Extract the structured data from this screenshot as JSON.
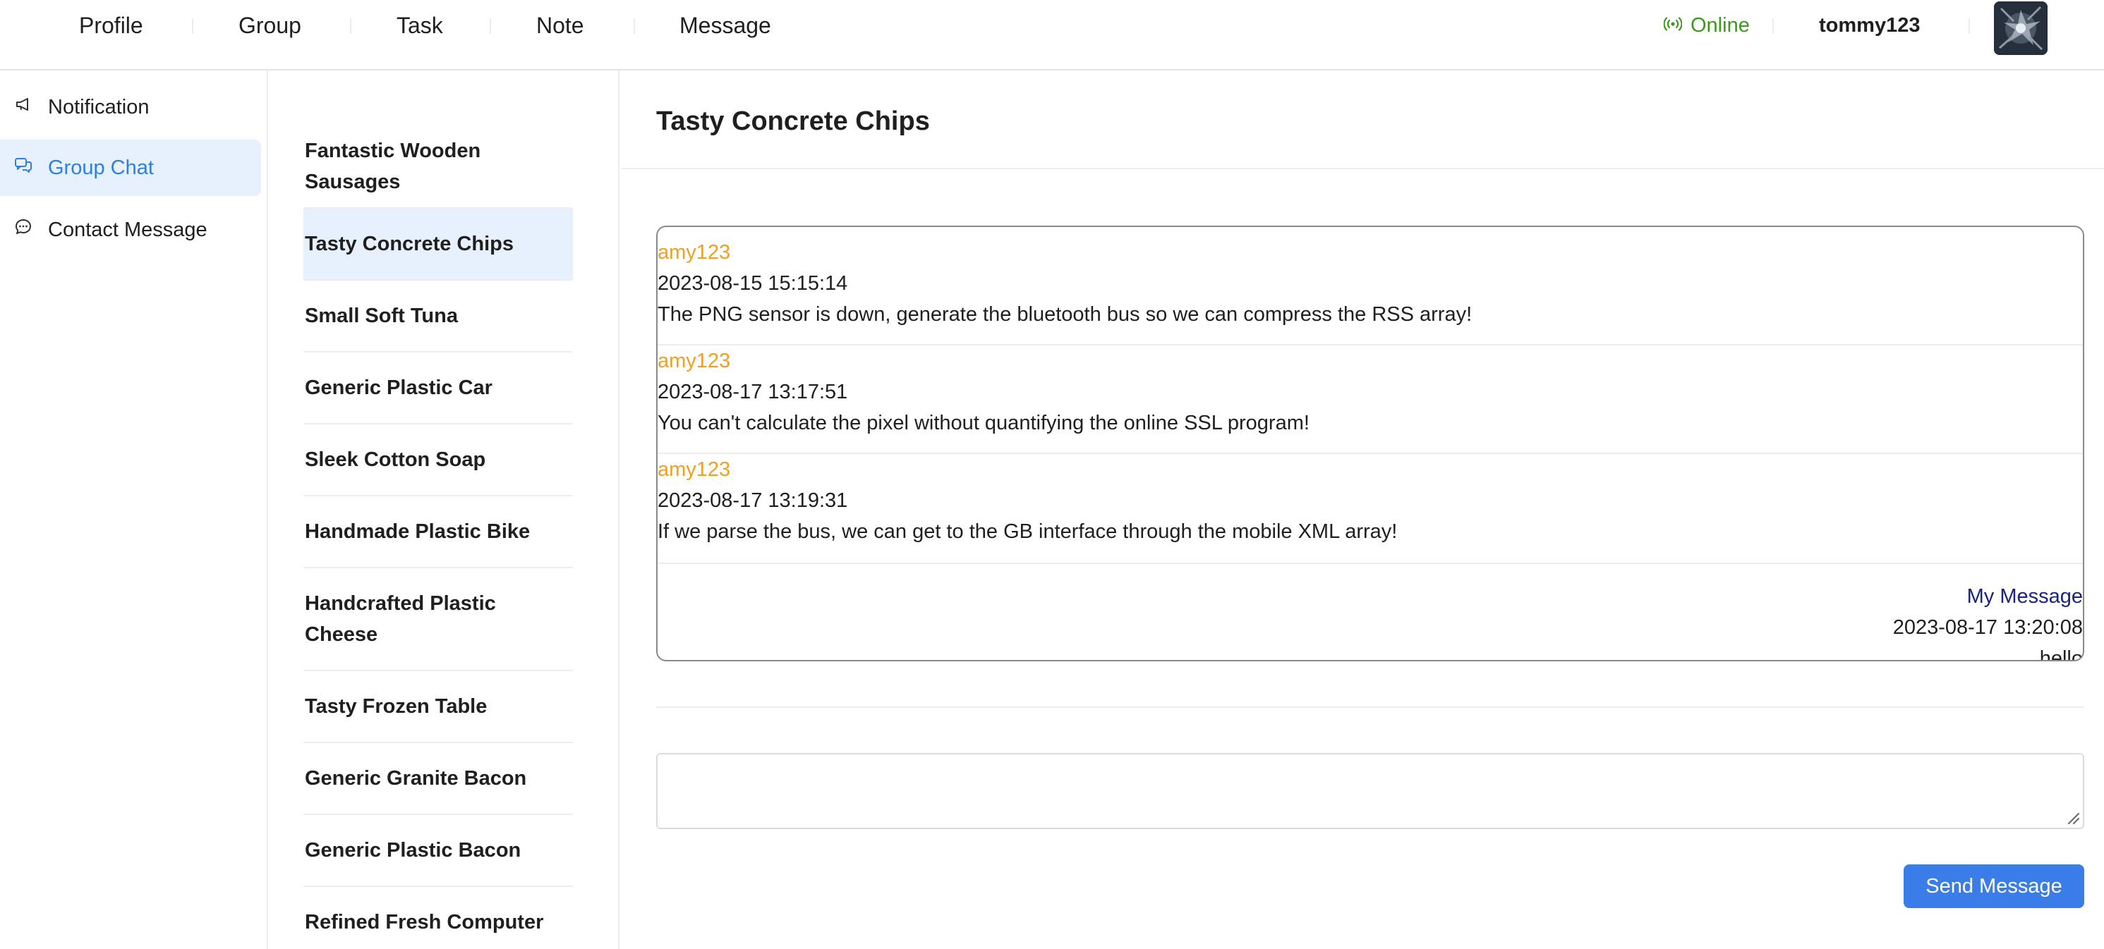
{
  "nav": {
    "items": [
      "Profile",
      "Group",
      "Task",
      "Note",
      "Message"
    ],
    "status": "Online",
    "username": "tommy123",
    "status_color": "#3a9a1a",
    "accent": "#3b7de8"
  },
  "sidebar": {
    "items": [
      {
        "label": "Notification",
        "icon": "megaphone-icon"
      },
      {
        "label": "Group Chat",
        "icon": "chat-bubbles-icon",
        "active": true
      },
      {
        "label": "Contact Message",
        "icon": "chat-dots-icon"
      }
    ]
  },
  "groups": {
    "items": [
      "Fantastic Wooden Sausages",
      "Tasty Concrete Chips",
      "Small Soft Tuna",
      "Generic Plastic Car",
      "Sleek Cotton Soap",
      "Handmade Plastic Bike",
      "Handcrafted Plastic Cheese",
      "Tasty Frozen Table",
      "Generic Granite Bacon",
      "Generic Plastic Bacon",
      "Refined Fresh Computer"
    ],
    "selected": "Tasty Concrete Chips"
  },
  "chat": {
    "title": "Tasty Concrete Chips",
    "messages": [
      {
        "author": "amy123",
        "time": "2023-08-15 15:15:14",
        "text": "The PNG sensor is down, generate the bluetooth bus so we can compress the RSS array!"
      },
      {
        "author": "amy123",
        "time": "2023-08-17 13:17:51",
        "text": "You can't calculate the pixel without quantifying the online SSL program!"
      },
      {
        "author": "amy123",
        "time": "2023-08-17 13:19:31",
        "text": "If we parse the bus, we can get to the GB interface through the mobile XML array!"
      },
      {
        "author": "My Message",
        "time": "2023-08-17 13:20:08",
        "text": "hello",
        "mine": true
      }
    ],
    "input_value": "",
    "send_label": "Send Message"
  }
}
